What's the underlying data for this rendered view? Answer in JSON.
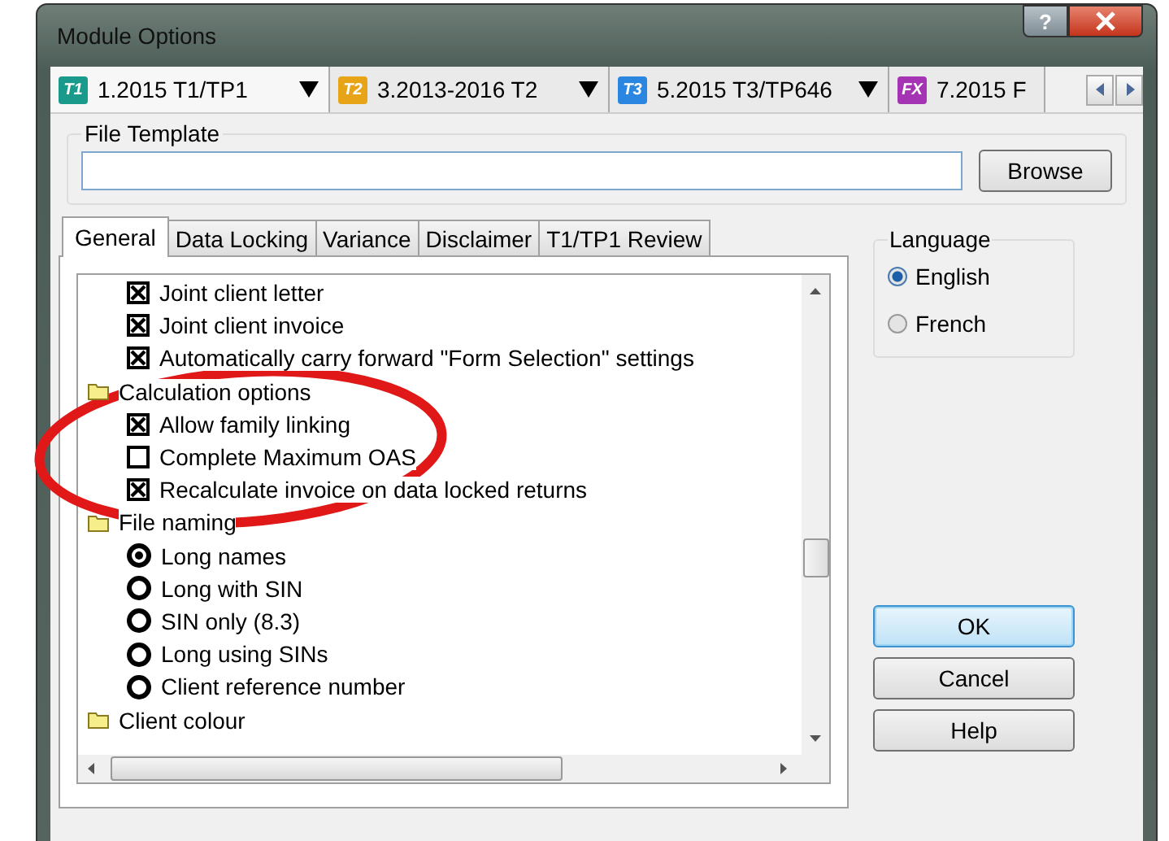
{
  "window": {
    "title": "Module Options",
    "help_button": "?"
  },
  "module_tabs": [
    {
      "label": "1.2015 T1/TP1",
      "badge": "T1",
      "color": "#1a9a8a",
      "selected": true
    },
    {
      "label": "3.2013-2016 T2",
      "badge": "T2",
      "color": "#e8a417",
      "selected": false
    },
    {
      "label": "5.2015 T3/TP646",
      "badge": "T3",
      "color": "#2a86e0",
      "selected": false
    },
    {
      "label": "7.2015 F",
      "badge": "FX",
      "color": "#a434b4",
      "selected": false
    }
  ],
  "file_template": {
    "legend": "File Template",
    "button": "Browse"
  },
  "tabs": [
    {
      "label": "General",
      "selected": true
    },
    {
      "label": "Data Locking",
      "selected": false
    },
    {
      "label": "Variance",
      "selected": false
    },
    {
      "label": "Disclaimer",
      "selected": false
    },
    {
      "label": "T1/TP1 Review",
      "selected": false
    }
  ],
  "tree": [
    {
      "kind": "continued",
      "children": [
        {
          "kind": "checkbox",
          "label": "Joint client letter",
          "checked": true
        },
        {
          "kind": "checkbox",
          "label": "Joint client invoice",
          "checked": true
        },
        {
          "kind": "checkbox",
          "label": "Automatically carry forward \"Form Selection\" settings",
          "checked": true
        }
      ]
    },
    {
      "kind": "folder",
      "label": "Calculation options",
      "children": [
        {
          "kind": "checkbox",
          "label": "Allow family linking",
          "checked": true
        },
        {
          "kind": "checkbox",
          "label": "Complete Maximum OAS",
          "checked": false
        },
        {
          "kind": "checkbox",
          "label": "Recalculate invoice on data locked returns",
          "checked": true
        }
      ]
    },
    {
      "kind": "folder",
      "label": "File naming",
      "children": [
        {
          "kind": "radio",
          "label": "Long names",
          "selected": true
        },
        {
          "kind": "radio",
          "label": "Long with SIN",
          "selected": false
        },
        {
          "kind": "radio",
          "label": "SIN only (8.3)",
          "selected": false
        },
        {
          "kind": "radio",
          "label": "Long using SINs",
          "selected": false
        },
        {
          "kind": "radio",
          "label": "Client reference number",
          "selected": false
        }
      ]
    },
    {
      "kind": "folder",
      "label": "Client colour"
    }
  ],
  "language": {
    "legend": "Language",
    "options": [
      {
        "label": "English",
        "selected": true
      },
      {
        "label": "French",
        "selected": false
      }
    ]
  },
  "buttons": [
    {
      "label": "OK",
      "default": true
    },
    {
      "label": "Cancel",
      "default": false
    },
    {
      "label": "Help",
      "default": false
    }
  ]
}
